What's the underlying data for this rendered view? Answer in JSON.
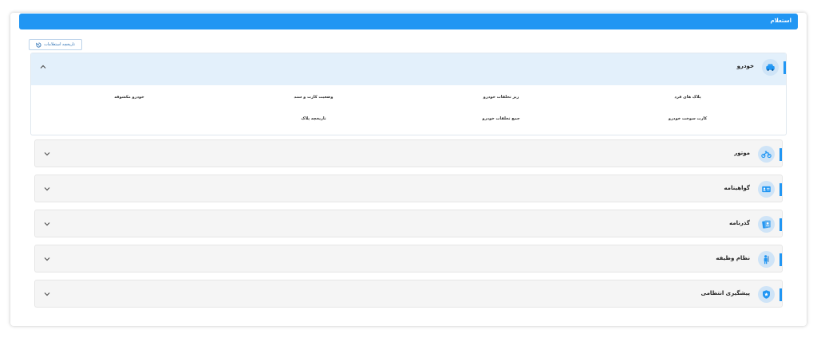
{
  "header": {
    "title": "استعلام"
  },
  "history_button": {
    "label": "تاریخچه استعلامات"
  },
  "open_panel": {
    "title": "خودرو",
    "items": [
      "پلاک های فرد",
      "ریز تخلفات خودرو",
      "وضعیت کارت و سند",
      "خودرو مکشوفه",
      "کارت سوخت خودرو",
      "جمع تخلفات خودرو",
      "تاریخچه پلاک"
    ]
  },
  "panels": [
    {
      "title": "موتور",
      "icon": "motorcycle-icon"
    },
    {
      "title": "گواهینامه",
      "icon": "license-card-icon"
    },
    {
      "title": "گذرنامه",
      "icon": "passport-icon"
    },
    {
      "title": "نظام وظیفه",
      "icon": "soldier-icon"
    },
    {
      "title": "پیشگیری انتظامی",
      "icon": "police-badge-icon"
    }
  ],
  "colors": {
    "accent": "#2196f3",
    "open_header": "#e3f0fb",
    "panel_bg": "#f5f5f5",
    "icon_bg": "#cfe4f7"
  }
}
